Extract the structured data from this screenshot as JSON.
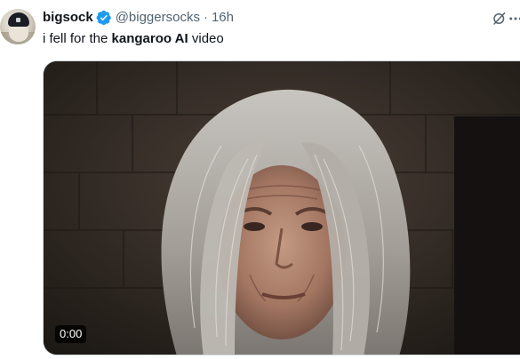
{
  "author": {
    "display_name": "bigsock",
    "handle": "@biggersocks",
    "separator": "·",
    "time": "16h"
  },
  "tweet": {
    "text_before": "i fell for the ",
    "text_bold": "kangaroo AI",
    "text_after": " video"
  },
  "media": {
    "timestamp": "0:00"
  },
  "icons": {
    "verified": "verified-badge-icon",
    "grok": "grok-icon",
    "more": "more-icon"
  },
  "colors": {
    "verified_blue": "#1d9bf0",
    "secondary_text": "#536471",
    "primary_text": "#0f1419"
  }
}
